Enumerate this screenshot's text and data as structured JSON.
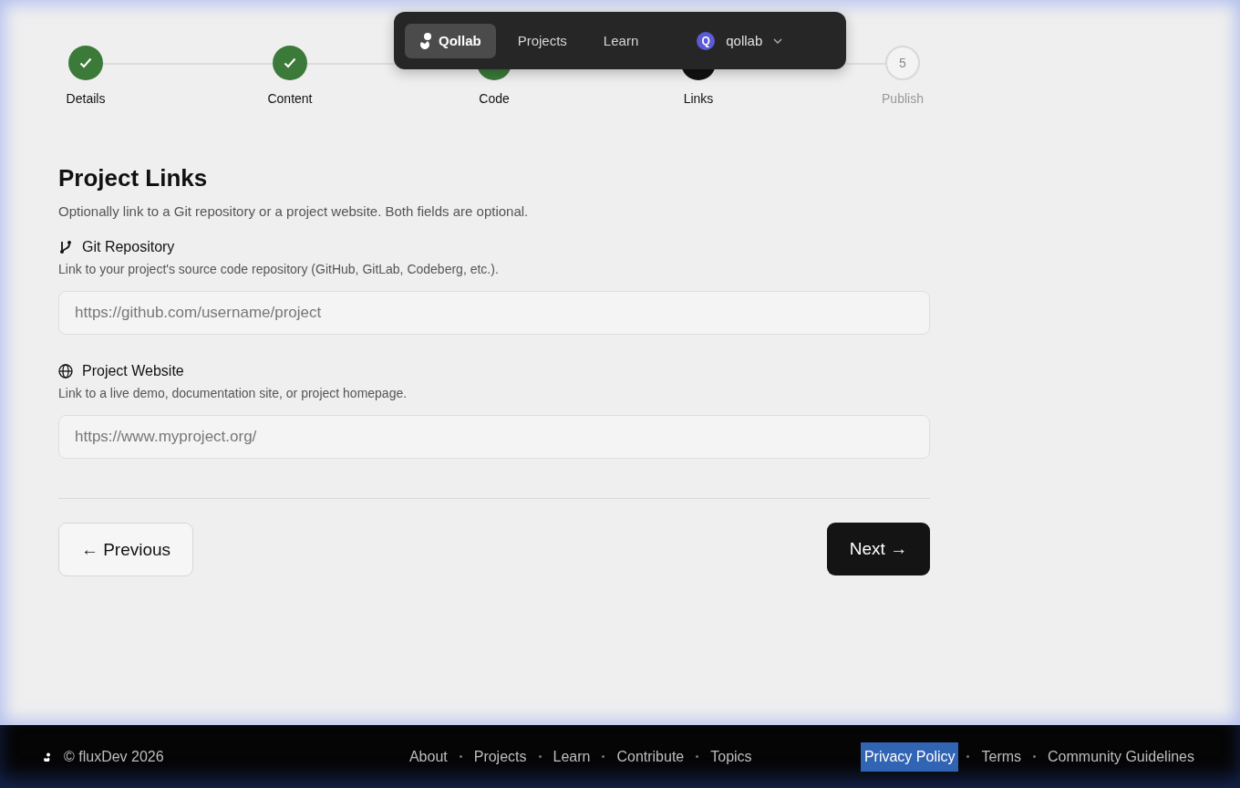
{
  "nav": {
    "items": [
      {
        "label": "Qollab",
        "kind": "brand",
        "selected": true
      },
      {
        "label": "Projects",
        "kind": "link",
        "selected": false
      },
      {
        "label": "Learn",
        "kind": "link",
        "selected": false
      }
    ],
    "user": {
      "avatar": "Q",
      "name": "qollab"
    }
  },
  "steps": [
    {
      "label": "Details",
      "kind": "done"
    },
    {
      "label": "Content",
      "kind": "done"
    },
    {
      "label": "Code",
      "kind": "done"
    },
    {
      "label": "Links",
      "kind": "current"
    },
    {
      "label": "Publish",
      "kind": "pending",
      "number": "5"
    }
  ],
  "section": {
    "title": "Project Links",
    "description": "Optionally link to a Git repository or a project website. Both fields are optional."
  },
  "fields": [
    {
      "kind": "git",
      "label": "Git Repository",
      "hint": "Link to your project's source code repository (GitHub, GitLab, Codeberg, etc.).",
      "placeholder": "https://github.com/username/project"
    },
    {
      "kind": "web",
      "label": "Project Website",
      "hint": "Link to a live demo, documentation site, or project homepage.",
      "placeholder": "https://www.myproject.org/"
    }
  ],
  "buttons": {
    "previous": "← Previous",
    "next": "Next →"
  },
  "footer": {
    "copyright": "© fluxDev 2026",
    "center_links": [
      {
        "label": "About",
        "highlighted": false
      },
      {
        "label": "Projects",
        "highlighted": false
      },
      {
        "label": "Learn",
        "highlighted": false
      },
      {
        "label": "Contribute",
        "highlighted": false
      },
      {
        "label": "Topics",
        "highlighted": false
      }
    ],
    "right_links": [
      {
        "label": "Privacy Policy",
        "highlighted": true
      },
      {
        "label": "Terms",
        "highlighted": false
      },
      {
        "label": "Community Guidelines",
        "highlighted": false
      }
    ]
  }
}
